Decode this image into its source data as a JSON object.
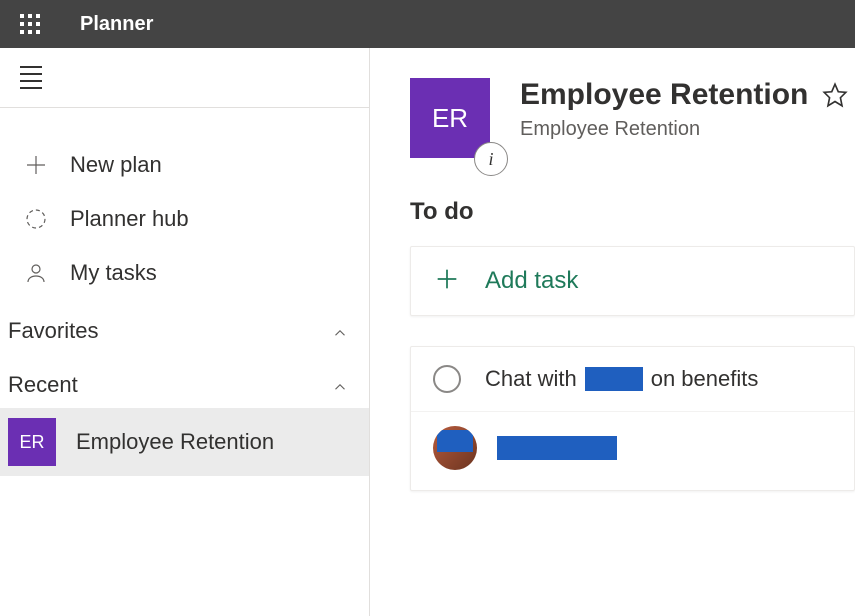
{
  "app": {
    "name": "Planner"
  },
  "sidebar": {
    "nav": [
      {
        "label": "New plan"
      },
      {
        "label": "Planner hub"
      },
      {
        "label": "My tasks"
      }
    ],
    "sections": {
      "favorites": {
        "label": "Favorites"
      },
      "recent": {
        "label": "Recent"
      }
    },
    "recent_items": [
      {
        "initials": "ER",
        "label": "Employee Retention"
      }
    ]
  },
  "plan": {
    "initials": "ER",
    "title": "Employee Retention",
    "group": "Employee Retention"
  },
  "bucket": {
    "title": "To do"
  },
  "add_task": {
    "label": "Add task"
  },
  "tasks": [
    {
      "title_prefix": "Chat with",
      "title_suffix": "on benefits"
    }
  ],
  "colors": {
    "brand_purple": "#6b2fb3",
    "action_green": "#1f7a5a",
    "redaction_blue": "#1f5fbf"
  }
}
